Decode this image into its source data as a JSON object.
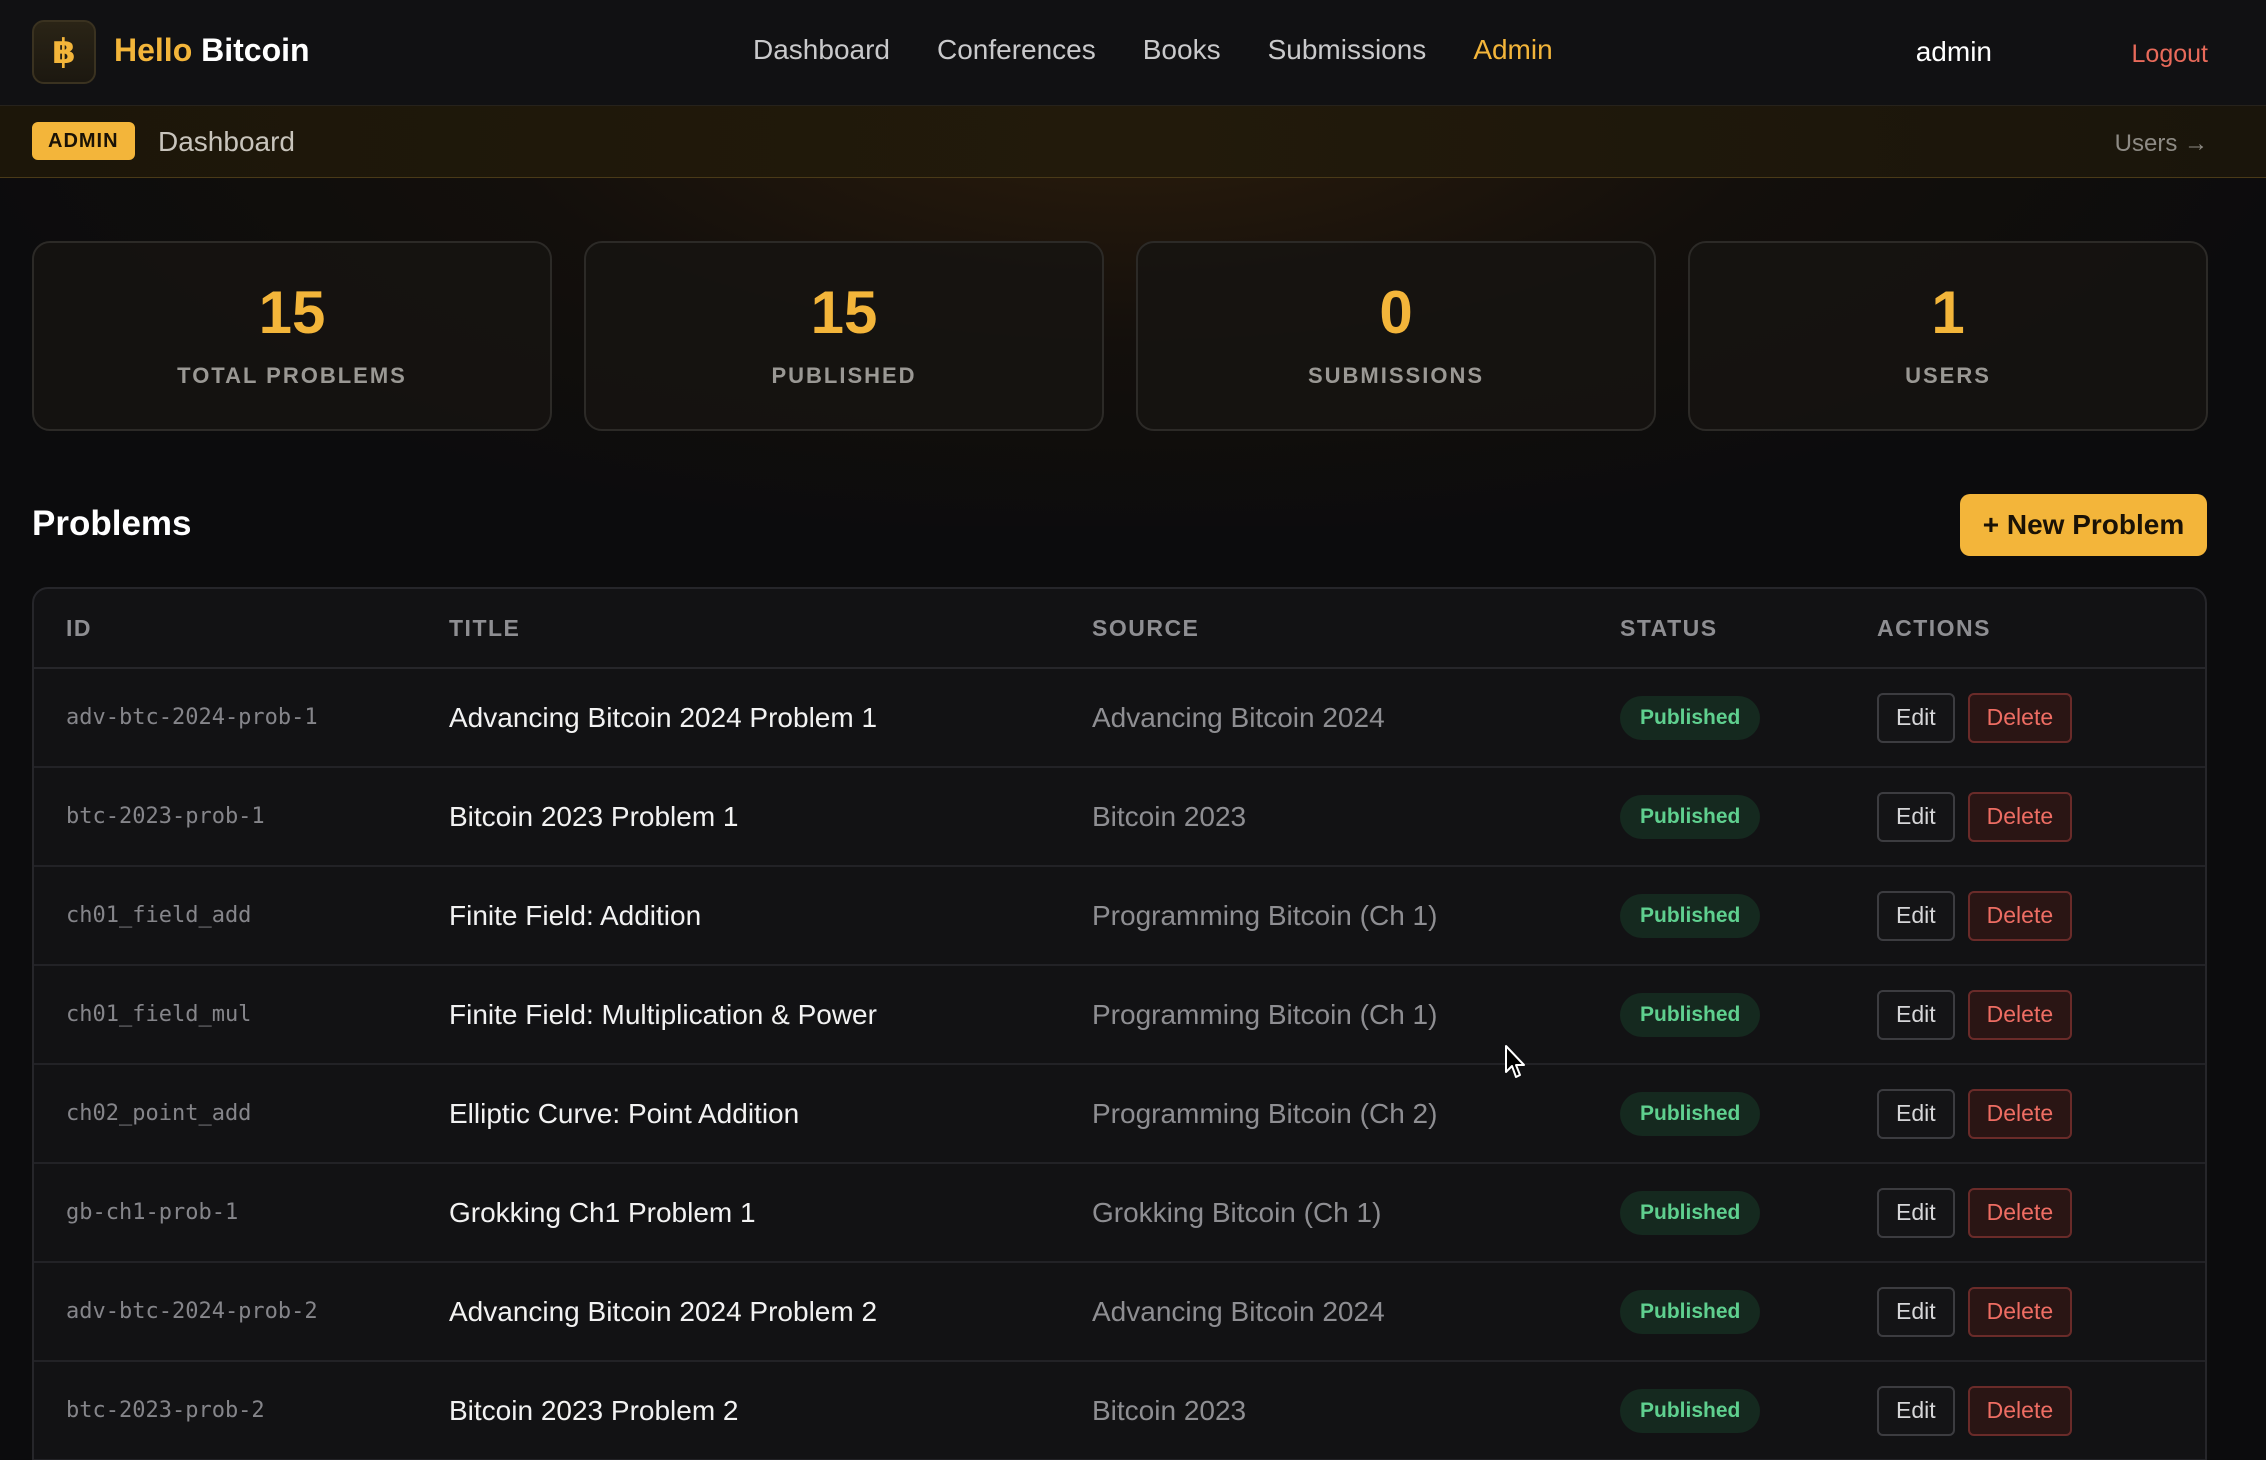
{
  "brand": {
    "icon_glyph": "฿",
    "name_part1": "Hello",
    "name_part2": "Bitcoin",
    "accent_color": "#f3b53a"
  },
  "nav": {
    "items": [
      {
        "label": "Dashboard"
      },
      {
        "label": "Conferences"
      },
      {
        "label": "Books"
      },
      {
        "label": "Submissions"
      },
      {
        "label": "Admin",
        "active": true
      }
    ]
  },
  "user": {
    "name": "admin",
    "logout_label": "Logout"
  },
  "subbar": {
    "badge": "ADMIN",
    "title": "Dashboard",
    "users_link": "Users →"
  },
  "stats": [
    {
      "value": "15",
      "label": "TOTAL PROBLEMS"
    },
    {
      "value": "15",
      "label": "PUBLISHED"
    },
    {
      "value": "0",
      "label": "SUBMISSIONS"
    },
    {
      "value": "1",
      "label": "USERS"
    }
  ],
  "problems": {
    "title": "Problems",
    "new_button": "+ New Problem",
    "columns": [
      "ID",
      "TITLE",
      "SOURCE",
      "STATUS",
      "ACTIONS"
    ],
    "edit_label": "Edit",
    "delete_label": "Delete",
    "rows": [
      {
        "id": "adv-btc-2024-prob-1",
        "title": "Advancing Bitcoin 2024 Problem 1",
        "source": "Advancing Bitcoin 2024",
        "status": "Published"
      },
      {
        "id": "btc-2023-prob-1",
        "title": "Bitcoin 2023 Problem 1",
        "source": "Bitcoin 2023",
        "status": "Published"
      },
      {
        "id": "ch01_field_add",
        "title": "Finite Field: Addition",
        "source": "Programming Bitcoin (Ch 1)",
        "status": "Published"
      },
      {
        "id": "ch01_field_mul",
        "title": "Finite Field: Multiplication & Power",
        "source": "Programming Bitcoin (Ch 1)",
        "status": "Published"
      },
      {
        "id": "ch02_point_add",
        "title": "Elliptic Curve: Point Addition",
        "source": "Programming Bitcoin (Ch 2)",
        "status": "Published"
      },
      {
        "id": "gb-ch1-prob-1",
        "title": "Grokking Ch1 Problem 1",
        "source": "Grokking Bitcoin (Ch 1)",
        "status": "Published"
      },
      {
        "id": "adv-btc-2024-prob-2",
        "title": "Advancing Bitcoin 2024 Problem 2",
        "source": "Advancing Bitcoin 2024",
        "status": "Published"
      },
      {
        "id": "btc-2023-prob-2",
        "title": "Bitcoin 2023 Problem 2",
        "source": "Bitcoin 2023",
        "status": "Published"
      }
    ]
  }
}
